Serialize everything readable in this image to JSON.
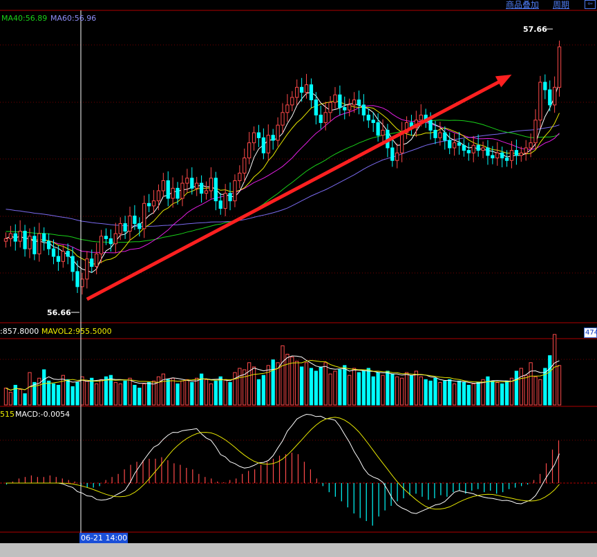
{
  "toolbar": {
    "overlay_label": "商品叠加",
    "period_label": "周期",
    "close_icon": "panel-close-icon"
  },
  "main_legend": {
    "ma40": "MA40:56.89",
    "ma60": "MA60:56.96"
  },
  "volume_legend": {
    "vol": ":857.8000",
    "mavol2": "MAVOL2:955.5000",
    "badge": "474"
  },
  "macd_legend": {
    "dif": "515",
    "macd": "MACD:-0.0054"
  },
  "cursor_time": "06-21 14:00",
  "chart_data": {
    "type": "candlestick",
    "price_annotations": {
      "low": "56.66",
      "high": "57.66"
    },
    "trend_arrow": {
      "from": [
        17,
        56.66
      ],
      "to": [
        106,
        57.55
      ]
    },
    "ylim": [
      56.6,
      57.75
    ],
    "closes": [
      56.9,
      56.92,
      56.89,
      56.93,
      56.86,
      56.91,
      56.84,
      56.92,
      56.89,
      56.86,
      56.83,
      56.81,
      56.85,
      56.83,
      56.77,
      56.71,
      56.74,
      56.82,
      56.79,
      56.84,
      56.91,
      56.9,
      56.88,
      56.92,
      56.96,
      56.93,
      56.99,
      56.96,
      56.94,
      57.04,
      57.03,
      57.05,
      57.09,
      57.13,
      57.06,
      57.1,
      57.06,
      57.12,
      57.14,
      57.1,
      57.12,
      57.08,
      57.09,
      57.14,
      57.05,
      57.02,
      57.08,
      57.05,
      57.13,
      57.16,
      57.22,
      57.28,
      57.32,
      57.3,
      57.24,
      57.31,
      57.29,
      57.35,
      57.4,
      57.43,
      57.46,
      57.5,
      57.48,
      57.51,
      57.45,
      57.39,
      57.36,
      57.4,
      57.44,
      57.47,
      57.42,
      57.41,
      57.43,
      57.45,
      57.43,
      57.39,
      57.37,
      57.36,
      57.31,
      57.33,
      57.26,
      57.21,
      57.24,
      57.32,
      57.36,
      57.34,
      57.37,
      57.39,
      57.37,
      57.33,
      57.3,
      57.32,
      57.29,
      57.26,
      57.28,
      57.27,
      57.25,
      57.24,
      57.27,
      57.25,
      57.26,
      57.23,
      57.22,
      57.24,
      57.22,
      57.21,
      57.25,
      57.23,
      57.24,
      57.26,
      57.28,
      57.37,
      57.52,
      57.49,
      57.43,
      57.5,
      57.66
    ],
    "volumes": [
      120,
      90,
      140,
      110,
      80,
      230,
      160,
      190,
      250,
      170,
      150,
      140,
      210,
      180,
      130,
      160,
      200,
      170,
      190,
      150,
      180,
      200,
      210,
      160,
      150,
      170,
      190,
      140,
      120,
      150,
      160,
      170,
      200,
      220,
      180,
      190,
      150,
      170,
      180,
      160,
      190,
      220,
      180,
      150,
      170,
      200,
      180,
      160,
      230,
      260,
      250,
      300,
      270,
      180,
      210,
      280,
      320,
      300,
      420,
      360,
      340,
      310,
      270,
      300,
      260,
      240,
      270,
      300,
      220,
      240,
      250,
      280,
      210,
      260,
      230,
      240,
      260,
      200,
      230,
      210,
      240,
      220,
      200,
      190,
      230,
      210,
      240,
      200,
      180,
      170,
      190,
      160,
      170,
      180,
      150,
      170,
      160,
      140,
      150,
      160,
      180,
      200,
      170,
      160,
      150,
      170,
      190,
      240,
      260,
      210,
      300,
      200,
      180,
      260,
      350,
      500,
      280
    ],
    "macd_hist": [
      -0.001,
      0.001,
      0.003,
      0.004,
      0.005,
      0.004,
      0.004,
      0.005,
      0.004,
      0.003,
      0.002,
      0.001,
      -0.002,
      -0.003,
      -0.003,
      -0.002,
      0.002,
      0.004,
      0.006,
      0.009,
      0.012,
      0.014,
      0.015,
      0.016,
      0.016,
      0.017,
      0.015,
      0.013,
      0.012,
      0.01,
      0.009,
      0.006,
      0.004,
      0.003,
      0.001,
      0.0005,
      0.002,
      0.003,
      0.006,
      0.008,
      0.009,
      0.012,
      0.014,
      0.016,
      0.018,
      0.019,
      0.02,
      0.019,
      0.014,
      0.009,
      0.003,
      -0.002,
      -0.006,
      -0.009,
      -0.012,
      -0.016,
      -0.02,
      -0.023,
      -0.025,
      -0.028,
      -0.022,
      -0.018,
      -0.015,
      -0.012,
      -0.01,
      -0.008,
      -0.007,
      -0.009,
      -0.011,
      -0.01,
      -0.008,
      -0.009,
      -0.006,
      -0.005,
      -0.007,
      -0.005,
      -0.004,
      -0.006,
      -0.005,
      -0.007,
      -0.006,
      -0.004,
      -0.003,
      -0.002,
      -0.001,
      0.002,
      0.006,
      0.013,
      0.022,
      0.028
    ]
  }
}
